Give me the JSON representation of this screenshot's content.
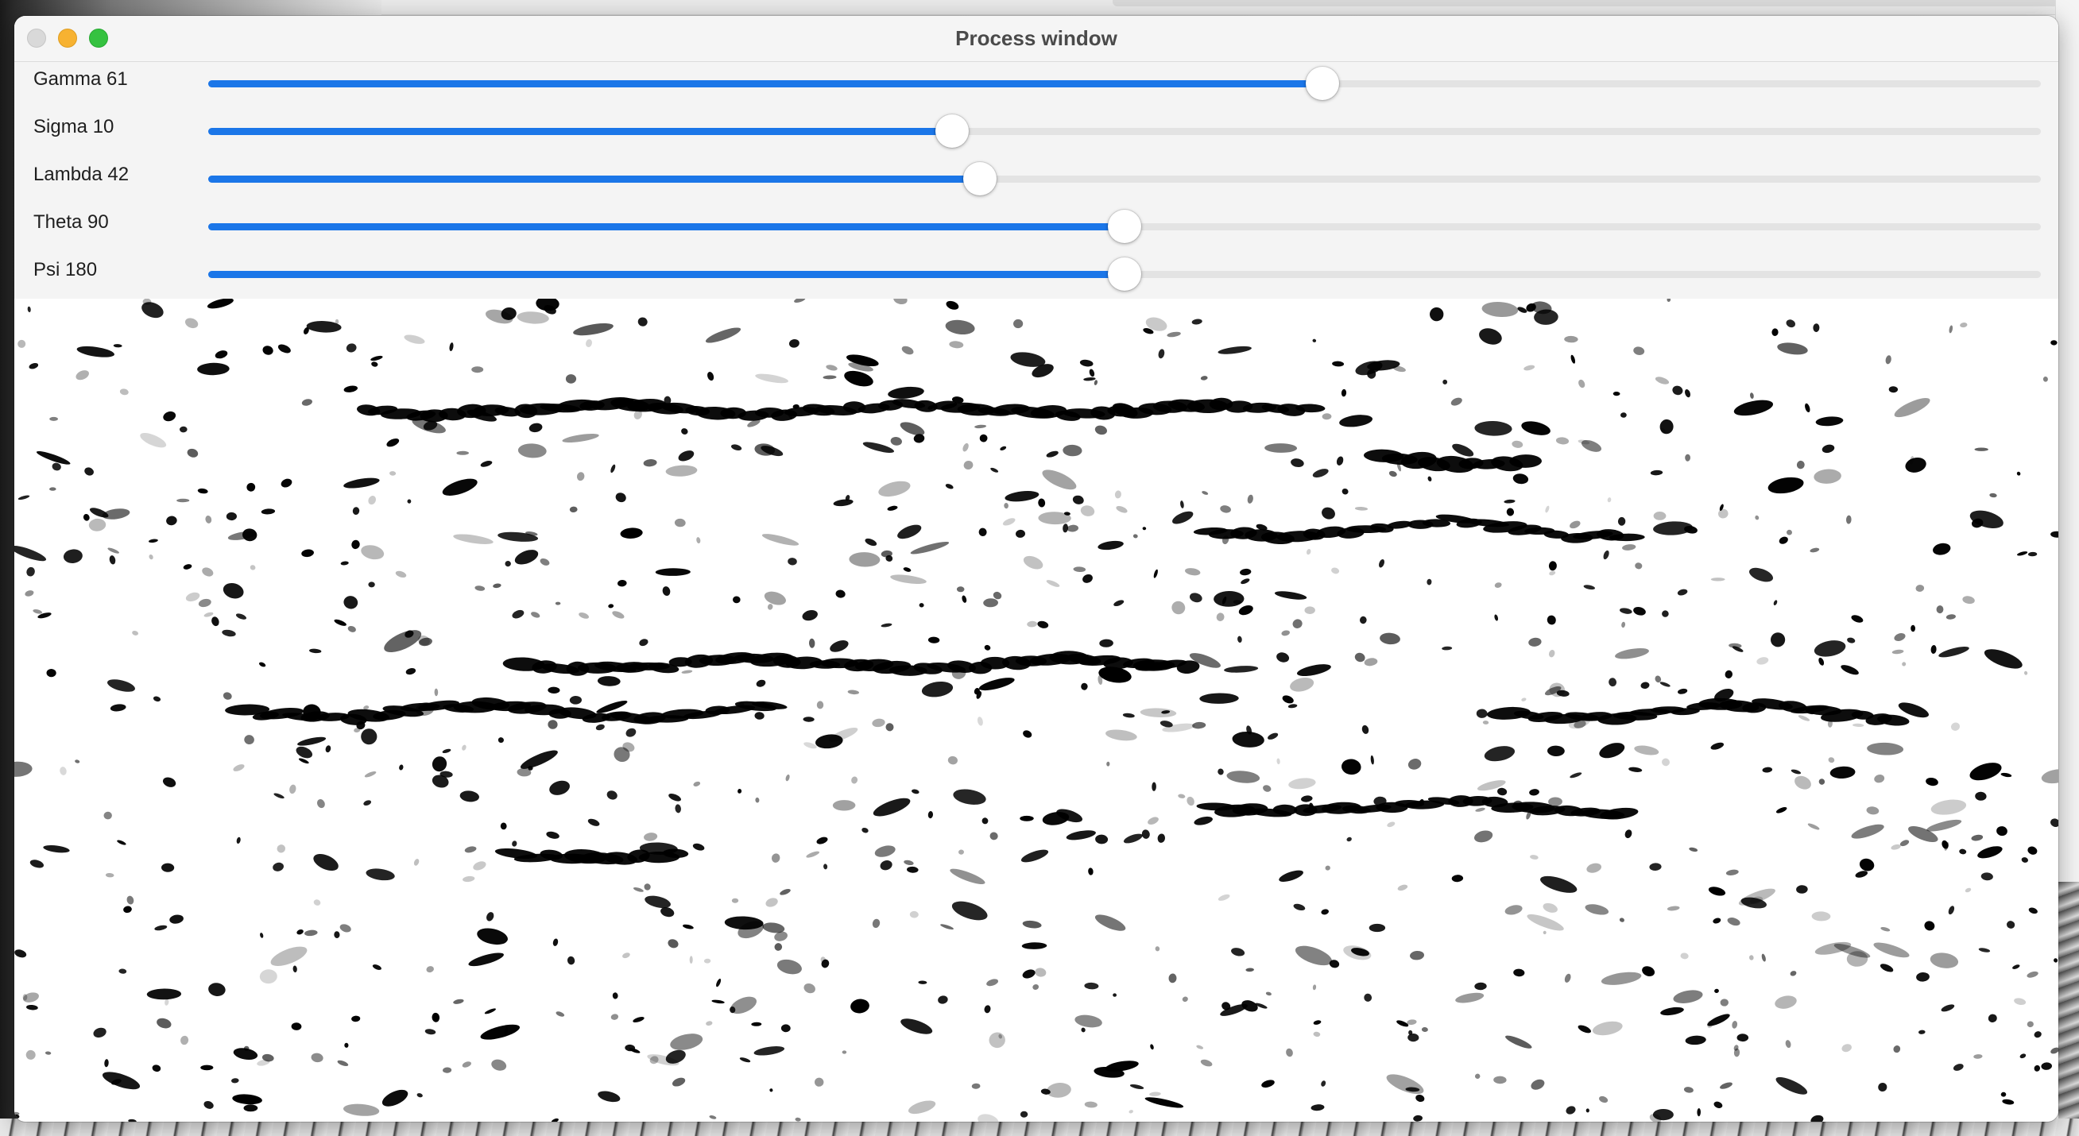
{
  "window": {
    "title": "Process window"
  },
  "sliders": [
    {
      "label": "Gamma 61",
      "fraction": 0.608
    },
    {
      "label": "Sigma 10",
      "fraction": 0.406
    },
    {
      "label": "Lambda 42",
      "fraction": 0.421
    },
    {
      "label": "Theta 90",
      "fraction": 0.5
    },
    {
      "label": "Psi 180",
      "fraction": 0.5
    }
  ],
  "colors": {
    "accent": "#1b76e8",
    "close_button": "#d9d9d9",
    "minimize_button": "#f7b231",
    "zoom_button": "#35c240"
  },
  "icons": [
    "close-button-icon",
    "minimize-button-icon",
    "zoom-button-icon"
  ]
}
